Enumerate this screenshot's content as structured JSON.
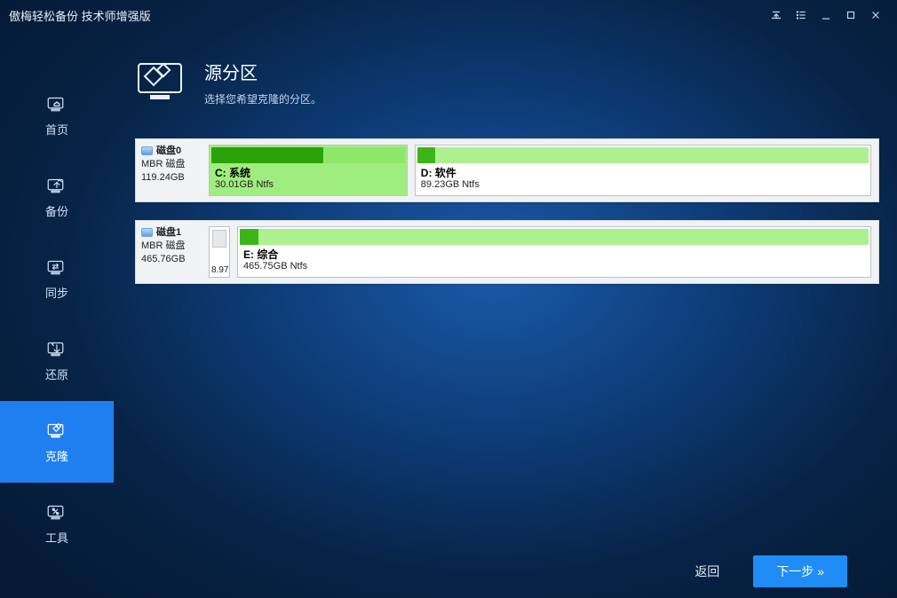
{
  "window": {
    "title": "傲梅轻松备份 技术师增强版"
  },
  "sidebar": {
    "items": [
      {
        "label": "首页"
      },
      {
        "label": "备份"
      },
      {
        "label": "同步"
      },
      {
        "label": "还原"
      },
      {
        "label": "克隆"
      },
      {
        "label": "工具"
      }
    ]
  },
  "header": {
    "title": "源分区",
    "subtitle": "选择您希望克隆的分区。"
  },
  "disks": [
    {
      "label": "磁盘0",
      "type": "MBR 磁盘",
      "size": "119.24GB",
      "partitions": [
        {
          "name": "C: 系统",
          "info": "30.01GB Ntfs",
          "usedPct": 57,
          "widthPct": 30,
          "selected": true
        },
        {
          "name": "D: 软件",
          "info": "89.23GB Ntfs",
          "usedPct": 4,
          "widthPct": 70,
          "selected": false
        }
      ]
    },
    {
      "label": "磁盘1",
      "type": "MBR 磁盘",
      "size": "465.76GB",
      "unallocated": {
        "size": "8.97"
      },
      "partitions": [
        {
          "name": "E: 综合",
          "info": "465.75GB Ntfs",
          "usedPct": 3,
          "widthPct": 100,
          "selected": false
        }
      ]
    }
  ],
  "footer": {
    "back": "返回",
    "next": "下一步 »"
  }
}
